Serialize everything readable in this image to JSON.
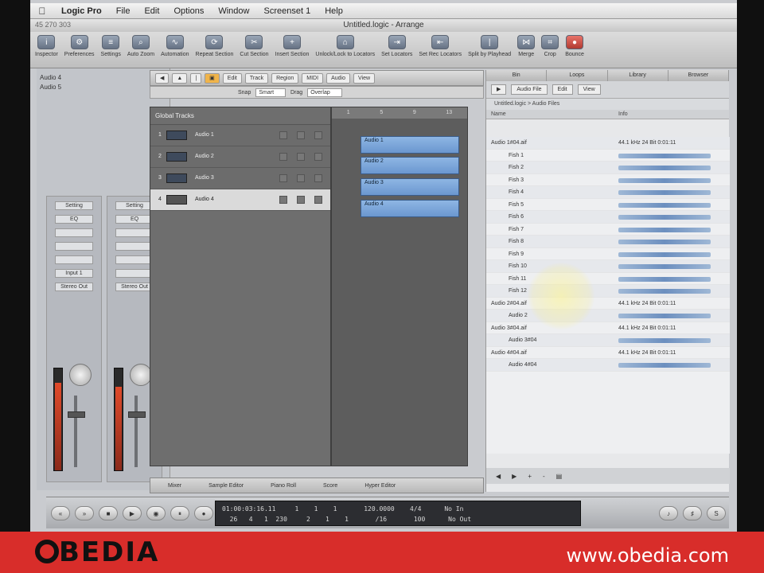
{
  "menubar": {
    "app": "Logic Pro",
    "items": [
      "File",
      "Edit",
      "Options",
      "Window",
      "Screenset 1",
      "Help"
    ]
  },
  "window": {
    "title": "Untitled.logic - Arrange",
    "position": "45 270 303"
  },
  "toolbar": {
    "items": [
      "Inspector",
      "Preferences",
      "Settings",
      "Auto Zoom",
      "Automation",
      "Repeat Section",
      "Cut Section",
      "Insert Section",
      "Unlock/Lock to Locators",
      "Set Locators",
      "Set Rec Locators",
      "Split by Playhead",
      "Merge",
      "Crop",
      "Bounce"
    ]
  },
  "inspector": {
    "region_label": "Audio 4",
    "region_sub": "Audio 5",
    "strips": [
      {
        "slots": [
          "Setting",
          "EQ",
          "",
          "",
          "",
          "Input 1",
          "Stereo Out"
        ],
        "level": 0.86
      },
      {
        "slots": [
          "Setting",
          "EQ",
          "",
          "",
          "",
          "",
          "Stereo Out"
        ],
        "level": 0.82
      }
    ]
  },
  "arrange": {
    "toolbar": [
      "",
      "",
      "",
      "",
      "Edit",
      "Track",
      "Region",
      "MIDI",
      "Audio",
      "View"
    ],
    "sub": {
      "snap_label": "Snap",
      "snap_value": "Smart",
      "drag_label": "Drag",
      "drag_value": "Overlap"
    },
    "folder": "Global Tracks",
    "tracks": [
      {
        "num": "1",
        "name": "Audio 1"
      },
      {
        "num": "2",
        "name": "Audio 2"
      },
      {
        "num": "3",
        "name": "Audio 3"
      },
      {
        "num": "4",
        "name": "Audio 4"
      }
    ],
    "ruler": [
      "1",
      "5",
      "9",
      "13"
    ],
    "regions": [
      "Audio 1",
      "Audio 2",
      "Audio 3",
      "Audio 4"
    ],
    "bottom": [
      "Mixer",
      "Sample Editor",
      "Piano Roll",
      "Score",
      "Hyper Editor"
    ]
  },
  "browser": {
    "tabs": [
      "Bin",
      "Loops",
      "Library",
      "Browser"
    ],
    "tools": [
      "Audio File",
      "Edit",
      "View"
    ],
    "path": "Untitled.logic > Audio Files",
    "head_name": "Name",
    "head_info": "Info",
    "rows": [
      {
        "name": "Audio 1#04.aif",
        "type": "top",
        "len": "44.1 kHz  24 Bit  0:01:11"
      },
      {
        "name": "Fish 1",
        "type": "sub"
      },
      {
        "name": "Fish 2",
        "type": "sub"
      },
      {
        "name": "Fish 3",
        "type": "sub"
      },
      {
        "name": "Fish 4",
        "type": "sub"
      },
      {
        "name": "Fish 5",
        "type": "sub"
      },
      {
        "name": "Fish 6",
        "type": "sub"
      },
      {
        "name": "Fish 7",
        "type": "sub"
      },
      {
        "name": "Fish 8",
        "type": "sub"
      },
      {
        "name": "Fish 9",
        "type": "sub"
      },
      {
        "name": "Fish 10",
        "type": "sub"
      },
      {
        "name": "Fish 11",
        "type": "sub"
      },
      {
        "name": "Fish 12",
        "type": "sub"
      },
      {
        "name": "Audio 2#04.aif",
        "type": "top",
        "len": "44.1 kHz  24 Bit  0:01:11"
      },
      {
        "name": "Audio 2",
        "type": "sub"
      },
      {
        "name": "Audio 3#04.aif",
        "type": "top",
        "len": "44.1 kHz  24 Bit  0:01:11"
      },
      {
        "name": "Audio 3#04",
        "type": "sub"
      },
      {
        "name": "Audio 4#04.aif",
        "type": "top",
        "len": "44.1 kHz  24 Bit  0:01:11"
      },
      {
        "name": "Audio 4#04",
        "type": "sub"
      }
    ],
    "footer": [
      "◀",
      "▶",
      "+",
      "-",
      "▤"
    ]
  },
  "transport": {
    "buttons": [
      "«",
      "»",
      "■",
      "▶",
      "◉",
      "⏸",
      "●"
    ],
    "lcd_line1": "01:00:03:16.11     1    1    1       120.0000    4/4      No In",
    "lcd_line2": "  26   4   1  230     2    1    1       /16       100      No Out"
  },
  "brand": {
    "logo_rest": "BEDIA",
    "url": "www.obedia.com"
  }
}
